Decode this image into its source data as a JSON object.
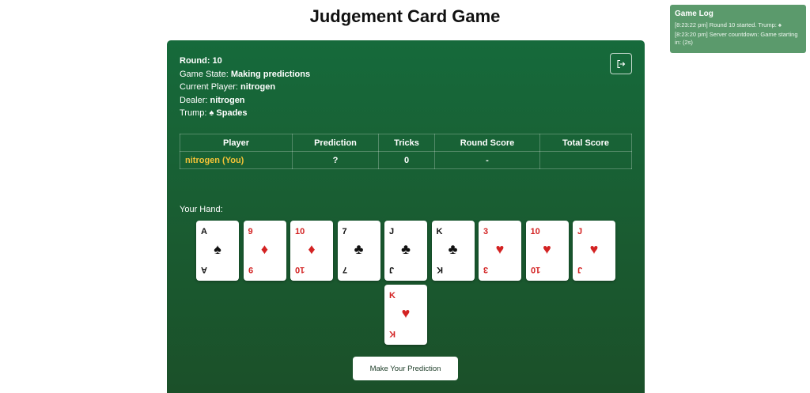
{
  "page": {
    "title": "Judgement Card Game"
  },
  "game_log": {
    "title": "Game Log",
    "entries": [
      "[8:23:22 pm] Round 10 started. Trump: ♠",
      "[8:23:20 pm] Server countdown: Game starting in: (2s)"
    ]
  },
  "info": {
    "round_label": "Round:",
    "round_value": "10",
    "state_label": "Game State:",
    "state_value": "Making predictions",
    "current_label": "Current Player:",
    "current_value": "nitrogen",
    "dealer_label": "Dealer:",
    "dealer_value": "nitrogen",
    "trump_label": "Trump:",
    "trump_value": "♠ Spades"
  },
  "table": {
    "headers": [
      "Player",
      "Prediction",
      "Tricks",
      "Round Score",
      "Total Score"
    ],
    "rows": [
      {
        "player": "nitrogen (You)",
        "prediction": "?",
        "tricks": "0",
        "round_score": "-",
        "total_score": ""
      }
    ]
  },
  "hand": {
    "label": "Your Hand:",
    "cards": [
      {
        "rank": "A",
        "suit": "♠",
        "color": "black"
      },
      {
        "rank": "9",
        "suit": "♦",
        "color": "red"
      },
      {
        "rank": "10",
        "suit": "♦",
        "color": "red"
      },
      {
        "rank": "7",
        "suit": "♣",
        "color": "black"
      },
      {
        "rank": "J",
        "suit": "♣",
        "color": "black"
      },
      {
        "rank": "K",
        "suit": "♣",
        "color": "black"
      },
      {
        "rank": "3",
        "suit": "♥",
        "color": "red"
      },
      {
        "rank": "10",
        "suit": "♥",
        "color": "red"
      },
      {
        "rank": "J",
        "suit": "♥",
        "color": "red"
      },
      {
        "rank": "K",
        "suit": "♥",
        "color": "red"
      }
    ]
  },
  "actions": {
    "predict_label": "Make Your Prediction"
  },
  "colors": {
    "board": "#166a3b",
    "log_bg": "#5b9a6c",
    "player_highlight": "#f3c237",
    "red_suit": "#d32222"
  }
}
